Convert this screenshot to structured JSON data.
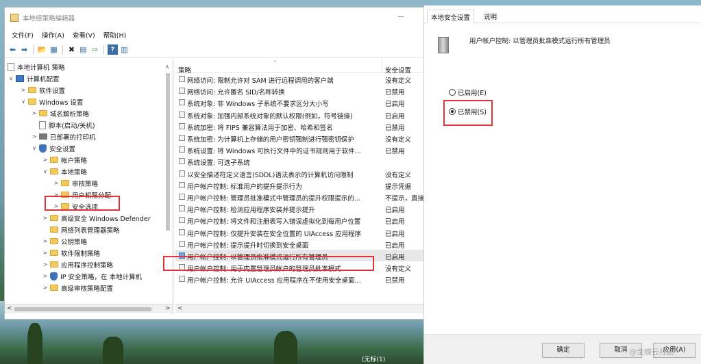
{
  "window": {
    "title": "本地组策略编辑器",
    "minimize_glyph": "—",
    "menu": [
      "文件(F)",
      "操作(A)",
      "查看(V)",
      "帮助(H)"
    ],
    "toolbar_icons": [
      "back-icon",
      "forward-icon",
      "up-folder-icon",
      "show-hide-tree-icon",
      "delete-icon",
      "properties-icon",
      "export-icon",
      "help-icon",
      "view-icon"
    ]
  },
  "tree": {
    "items": [
      {
        "label": "本地计算机 策略",
        "chev": "",
        "icon": "doc"
      },
      {
        "label": "计算机配置",
        "chev": "v",
        "icon": "pc"
      },
      {
        "label": "软件设置",
        "chev": ">",
        "icon": "folder"
      },
      {
        "label": "Windows 设置",
        "chev": "v",
        "icon": "folder"
      },
      {
        "label": "域名解析策略",
        "chev": ">",
        "icon": "folder"
      },
      {
        "label": "脚本(启动/关机)",
        "chev": "",
        "icon": "doc"
      },
      {
        "label": "已部署的打印机",
        "chev": ">",
        "icon": "printer"
      },
      {
        "label": "安全设置",
        "chev": "v",
        "icon": "shield"
      },
      {
        "label": "帐户策略",
        "chev": ">",
        "icon": "folder"
      },
      {
        "label": "本地策略",
        "chev": "v",
        "icon": "folder"
      },
      {
        "label": "审核策略",
        "chev": ">",
        "icon": "folder"
      },
      {
        "label": "用户权限分配",
        "chev": ">",
        "icon": "folder"
      },
      {
        "label": "安全选项",
        "chev": ">",
        "icon": "folder"
      },
      {
        "label": "高级安全 Windows Defender",
        "chev": ">",
        "icon": "folder"
      },
      {
        "label": "网络列表管理器策略",
        "chev": "",
        "icon": "folder"
      },
      {
        "label": "公钥策略",
        "chev": ">",
        "icon": "folder"
      },
      {
        "label": "软件限制策略",
        "chev": ">",
        "icon": "folder"
      },
      {
        "label": "应用程序控制策略",
        "chev": ">",
        "icon": "folder"
      },
      {
        "label": "IP 安全策略，在 本地计算机",
        "chev": ">",
        "icon": "shield"
      },
      {
        "label": "高级审核策略配置",
        "chev": ">",
        "icon": "folder"
      }
    ],
    "hscroll_left": "<",
    "hscroll_right": ">"
  },
  "list": {
    "columns": {
      "policy": "策略",
      "setting": "安全设置"
    },
    "sort_glyph": "^",
    "rows": [
      {
        "name": "网络访问: 限制允许对 SAM 进行远程调用的客户端",
        "value": "没有定义"
      },
      {
        "name": "网络访问: 允许匿名 SID/名称转换",
        "value": "已禁用"
      },
      {
        "name": "系统对象: 非 Windows 子系统不要求区分大小写",
        "value": "已启用"
      },
      {
        "name": "系统对象: 加强内部系统对象的默认权限(例如，符号链接)",
        "value": "已启用"
      },
      {
        "name": "系统加密: 将 FIPS 兼容算法用于加密、哈希和签名",
        "value": "已禁用"
      },
      {
        "name": "系统加密: 为计算机上存储的用户密钥强制进行强密钥保护",
        "value": "没有定义"
      },
      {
        "name": "系统设置: 将 Windows 可执行文件中的证书规则用于软件...",
        "value": "已禁用"
      },
      {
        "name": "系统设置: 可选子系统",
        "value": ""
      },
      {
        "name": "以安全描述符定义语言(SDDL)语法表示的计算机访问限制",
        "value": "没有定义"
      },
      {
        "name": "用户帐户控制: 标准用户的提升提示行为",
        "value": "提示凭据"
      },
      {
        "name": "用户帐户控制: 管理员批准模式中管理员的提升权限提示的...",
        "value": "不提示，直接"
      },
      {
        "name": "用户帐户控制: 检测应用程序安装并提示提升",
        "value": "已启用"
      },
      {
        "name": "用户帐户控制: 将文件和注册表写入错误虚拟化到每用户位置",
        "value": "已启用"
      },
      {
        "name": "用户帐户控制: 仅提升安装在安全位置的 UIAccess 应用程序",
        "value": "已启用"
      },
      {
        "name": "用户帐户控制: 提示提升时切换到安全桌面",
        "value": "已启用"
      },
      {
        "name": "用户帐户控制: 以管理员批准模式运行所有管理员",
        "value": "已启用"
      },
      {
        "name": "用户帐户控制: 用于内置管理员帐户的管理员批准模式",
        "value": "没有定义"
      },
      {
        "name": "用户帐户控制: 允许 UIAccess 应用程序在不使用安全桌面...",
        "value": "已禁用"
      }
    ],
    "selected_index": 15,
    "hscroll_left": "<"
  },
  "dialog": {
    "tabs": [
      "本地安全设置",
      "说明"
    ],
    "policy_title": "用户帐户控制: 以管理员批准模式运行所有管理员",
    "options": [
      {
        "label": "已启用(E)",
        "checked": false
      },
      {
        "label": "已禁用(S)",
        "checked": true
      }
    ],
    "buttons": {
      "ok": "确定",
      "cancel": "取消",
      "apply": "应用(A)"
    }
  },
  "watermark": "@金蝶云社区",
  "taskbar_label": "(无标(1)",
  "colors": {
    "highlight": "#e0333a",
    "selected_row": "#e7e7e7"
  }
}
